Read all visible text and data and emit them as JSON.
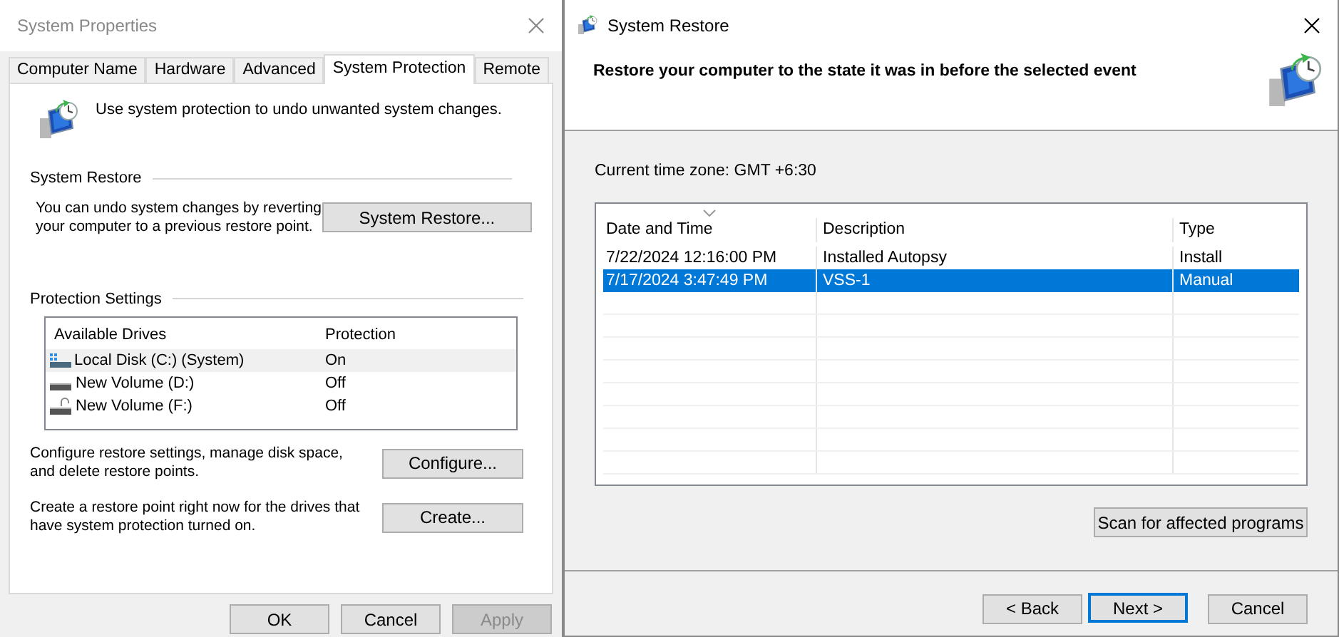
{
  "system_properties": {
    "title": "System Properties",
    "tabs": [
      {
        "label": "Computer Name",
        "selected": false
      },
      {
        "label": "Hardware",
        "selected": false
      },
      {
        "label": "Advanced",
        "selected": false
      },
      {
        "label": "System Protection",
        "selected": true
      },
      {
        "label": "Remote",
        "selected": false
      }
    ],
    "intro": "Use system protection to undo unwanted system changes.",
    "system_restore": {
      "heading": "System Restore",
      "text": "You can undo system changes by reverting your computer to a previous restore point.",
      "button": "System Restore..."
    },
    "protection_settings": {
      "heading": "Protection Settings",
      "columns": [
        "Available Drives",
        "Protection"
      ],
      "drives": [
        {
          "name": "Local Disk (C:) (System)",
          "protection": "On",
          "kind": "system",
          "selected": true
        },
        {
          "name": "New Volume (D:)",
          "protection": "Off",
          "kind": "drive",
          "selected": false
        },
        {
          "name": "New Volume (F:)",
          "protection": "Off",
          "kind": "locked",
          "selected": false
        }
      ]
    },
    "configure": {
      "text": "Configure restore settings, manage disk space, and delete restore points.",
      "button": "Configure..."
    },
    "create": {
      "text": "Create a restore point right now for the drives that have system protection turned on.",
      "button": "Create..."
    },
    "buttons": [
      {
        "label": "OK",
        "disabled": false
      },
      {
        "label": "Cancel",
        "disabled": false
      },
      {
        "label": "Apply",
        "disabled": true
      }
    ]
  },
  "system_restore": {
    "title": "System Restore",
    "heading": "Restore your computer to the state it was in before the selected event",
    "time_zone": "Current time zone: GMT +6:30",
    "columns": [
      "Date and Time",
      "Description",
      "Type"
    ],
    "restore_points": [
      {
        "date": "7/22/2024 12:16:00 PM",
        "description": "Installed Autopsy",
        "type": "Install",
        "selected": false
      },
      {
        "date": "7/17/2024 3:47:49 PM",
        "description": "VSS-1",
        "type": "Manual",
        "selected": true
      }
    ],
    "scan_button": "Scan for affected programs",
    "buttons": [
      {
        "label": "< Back",
        "default": false
      },
      {
        "label": "Next >",
        "default": true
      },
      {
        "label": "Cancel",
        "default": false
      }
    ]
  }
}
